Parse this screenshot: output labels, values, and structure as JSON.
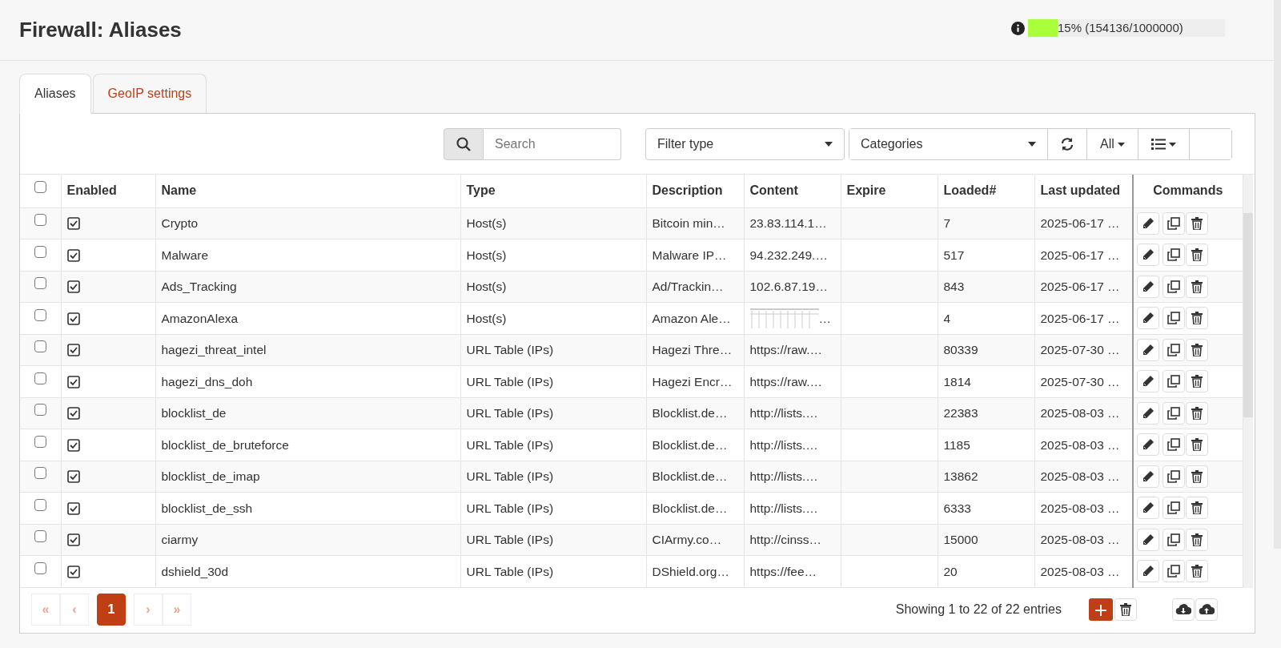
{
  "page": {
    "title": "Firewall: Aliases"
  },
  "usage": {
    "level": 0.15,
    "reading": "15% (154136/1000000)"
  },
  "tabs": [
    {
      "label": "Aliases",
      "selected": true
    },
    {
      "label": "GeoIP settings",
      "selected": false
    }
  ],
  "toolbar": {
    "search": {
      "placeholder": "Search"
    },
    "filter_type": {
      "label": "Filter type"
    },
    "categories": {
      "label": "Categories"
    },
    "row_count": "All"
  },
  "table": {
    "select_all": false,
    "columns": [
      "Enabled",
      "Name",
      "Type",
      "Description",
      "Content",
      "Expire",
      "Loaded#",
      "Last updated",
      "Commands"
    ],
    "rows": [
      {
        "selected": false,
        "enabled": true,
        "name": "Crypto",
        "type": "Host(s)",
        "description": "Bitcoin min…",
        "content": "23.83.114.1…",
        "garbled": false,
        "loaded": "7",
        "updated": "2025-06-17 …"
      },
      {
        "selected": false,
        "enabled": true,
        "name": "Malware",
        "type": "Host(s)",
        "description": "Malware IP…",
        "content": "94.232.249.…",
        "garbled": false,
        "loaded": "517",
        "updated": "2025-06-17 …"
      },
      {
        "selected": false,
        "enabled": true,
        "name": "Ads_Tracking",
        "type": "Host(s)",
        "description": "Ad/Trackin…",
        "content": "102.6.87.19…",
        "garbled": false,
        "loaded": "843",
        "updated": "2025-06-17 …"
      },
      {
        "selected": false,
        "enabled": true,
        "name": "AmazonAlexa",
        "type": "Host(s)",
        "description": "Amazon Ale…",
        "content": "…",
        "garbled": true,
        "loaded": "4",
        "updated": "2025-06-17 …"
      },
      {
        "selected": false,
        "enabled": true,
        "name": "hagezi_threat_intel",
        "type": "URL Table (IPs)",
        "description": "Hagezi Thre…",
        "content": "https://raw.…",
        "garbled": false,
        "loaded": "80339",
        "updated": "2025-07-30 …"
      },
      {
        "selected": false,
        "enabled": true,
        "name": "hagezi_dns_doh",
        "type": "URL Table (IPs)",
        "description": "Hagezi Encr…",
        "content": "https://raw.…",
        "garbled": false,
        "loaded": "1814",
        "updated": "2025-07-30 …"
      },
      {
        "selected": false,
        "enabled": true,
        "name": "blocklist_de",
        "type": "URL Table (IPs)",
        "description": "Blocklist.de…",
        "content": "http://lists.…",
        "garbled": false,
        "loaded": "22383",
        "updated": "2025-08-03 …"
      },
      {
        "selected": false,
        "enabled": true,
        "name": "blocklist_de_bruteforce",
        "type": "URL Table (IPs)",
        "description": "Blocklist.de…",
        "content": "http://lists.…",
        "garbled": false,
        "loaded": "1185",
        "updated": "2025-08-03 …"
      },
      {
        "selected": false,
        "enabled": true,
        "name": "blocklist_de_imap",
        "type": "URL Table (IPs)",
        "description": "Blocklist.de…",
        "content": "http://lists.…",
        "garbled": false,
        "loaded": "13862",
        "updated": "2025-08-03 …"
      },
      {
        "selected": false,
        "enabled": true,
        "name": "blocklist_de_ssh",
        "type": "URL Table (IPs)",
        "description": "Blocklist.de…",
        "content": "http://lists.…",
        "garbled": false,
        "loaded": "6333",
        "updated": "2025-08-03 …"
      },
      {
        "selected": false,
        "enabled": true,
        "name": "ciarmy",
        "type": "URL Table (IPs)",
        "description": "CIArmy.co…",
        "content": "http://cinss…",
        "garbled": false,
        "loaded": "15000",
        "updated": "2025-08-03 …"
      },
      {
        "selected": false,
        "enabled": true,
        "name": "dshield_30d",
        "type": "URL Table (IPs)",
        "description": "DShield.org…",
        "content": "https://fee…",
        "garbled": false,
        "loaded": "20",
        "updated": "2025-08-03 …"
      }
    ]
  },
  "pagination": [
    {
      "label": "«",
      "kind": "nav",
      "selected": false
    },
    {
      "label": "‹",
      "kind": "nav",
      "selected": false
    },
    {
      "label": "1",
      "kind": "page",
      "selected": true
    },
    {
      "label": "›",
      "kind": "nav",
      "selected": false
    },
    {
      "label": "»",
      "kind": "nav",
      "selected": false
    }
  ],
  "info": "Showing 1 to 22 of 22 entries"
}
